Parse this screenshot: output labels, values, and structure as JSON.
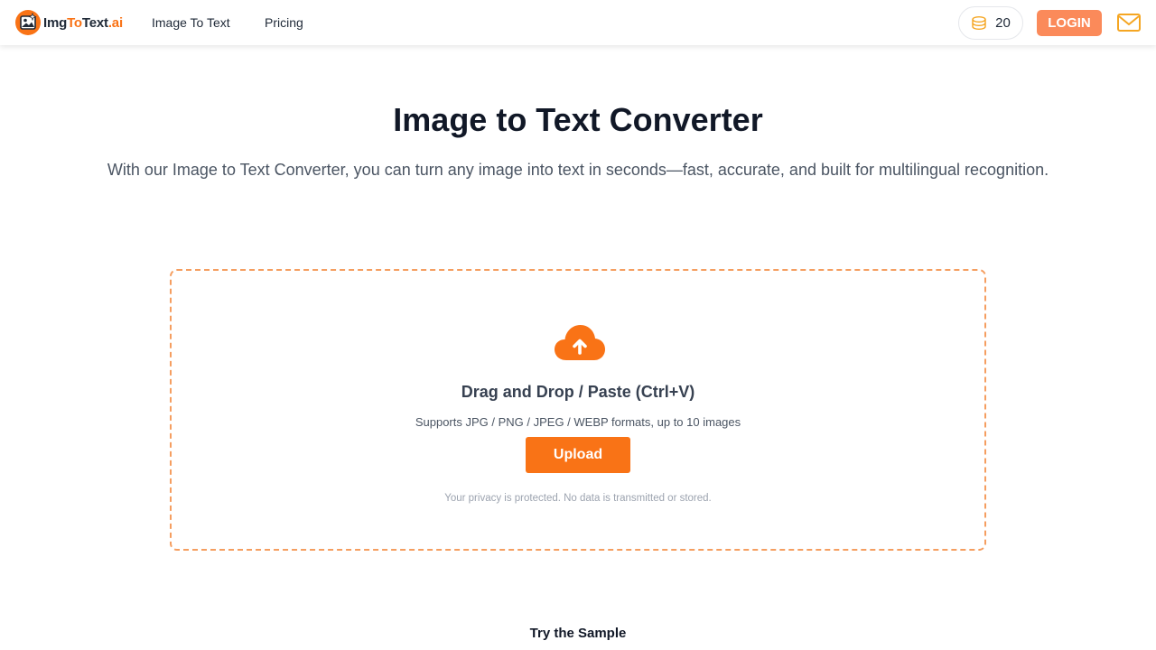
{
  "header": {
    "logo": {
      "part1": "Img",
      "part2": "To",
      "part3": "Text",
      "part4": ".ai",
      "icon": "logo-photo-icon"
    },
    "nav": [
      {
        "label": "Image To Text"
      },
      {
        "label": "Pricing"
      }
    ],
    "credits": {
      "icon": "coin-stack-icon",
      "count": "20"
    },
    "login_label": "LOGIN",
    "mail_icon": "mail-icon"
  },
  "hero": {
    "title": "Image to Text Converter",
    "subtitle": "With our Image to Text Converter, you can turn any image into text in seconds—fast, accurate, and built for multilingual recognition."
  },
  "upload": {
    "icon": "cloud-upload-icon",
    "title": "Drag and Drop / Paste (Ctrl+V)",
    "formats": "Supports JPG / PNG / JPEG / WEBP formats, up to 10 images",
    "button_label": "Upload",
    "privacy": "Your privacy is protected. No data is transmitted or stored."
  },
  "sample": {
    "label": "Try the Sample"
  },
  "colors": {
    "accent": "#f97316",
    "login": "#fb8a5a",
    "dropzone_border": "#f59e60",
    "coin": "#f5a623"
  }
}
